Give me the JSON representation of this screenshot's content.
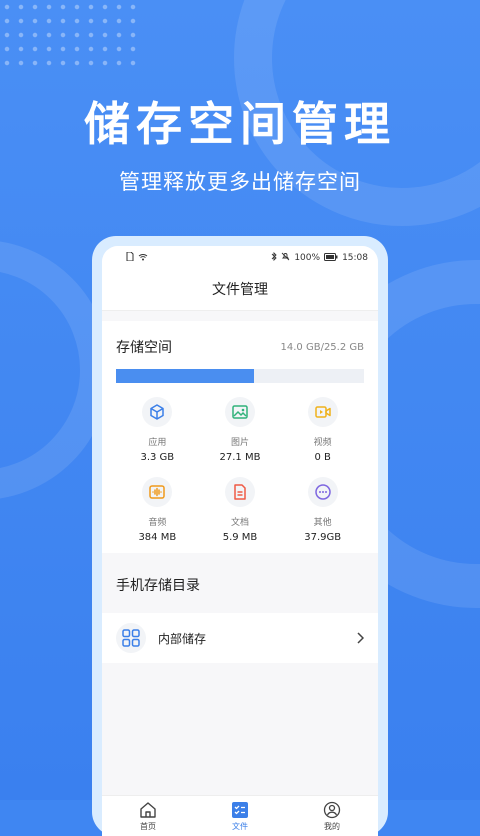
{
  "promo": {
    "headline": "储存空间管理",
    "subline": "管理释放更多出储存空间"
  },
  "status_bar": {
    "battery": "100%",
    "time": "15:08"
  },
  "app_bar": {
    "title": "文件管理"
  },
  "storage": {
    "title": "存储空间",
    "usage": "14.0 GB/25.2 GB",
    "used_fraction": 0.556,
    "accent": "#4a8ef0",
    "categories": [
      {
        "label": "应用",
        "value": "3.3 GB",
        "icon": "cube-icon",
        "color": "#3b7fe8"
      },
      {
        "label": "图片",
        "value": "27.1 MB",
        "icon": "image-icon",
        "color": "#2fb27a"
      },
      {
        "label": "视频",
        "value": "0 B",
        "icon": "video-icon",
        "color": "#f0b21c"
      },
      {
        "label": "音频",
        "value": "384 MB",
        "icon": "audio-icon",
        "color": "#f09a1c"
      },
      {
        "label": "文档",
        "value": "5.9 MB",
        "icon": "document-icon",
        "color": "#ef5a45"
      },
      {
        "label": "其他",
        "value": "37.9GB",
        "icon": "more-icon",
        "color": "#7d66e0"
      }
    ]
  },
  "directory": {
    "title": "手机存储目录",
    "items": [
      {
        "label": "内部储存",
        "icon": "grid-icon"
      }
    ]
  },
  "tabs": [
    {
      "label": "首页",
      "icon": "home-icon",
      "active": false
    },
    {
      "label": "文件",
      "icon": "file-tab-icon",
      "active": true
    },
    {
      "label": "我的",
      "icon": "profile-icon",
      "active": false
    }
  ]
}
